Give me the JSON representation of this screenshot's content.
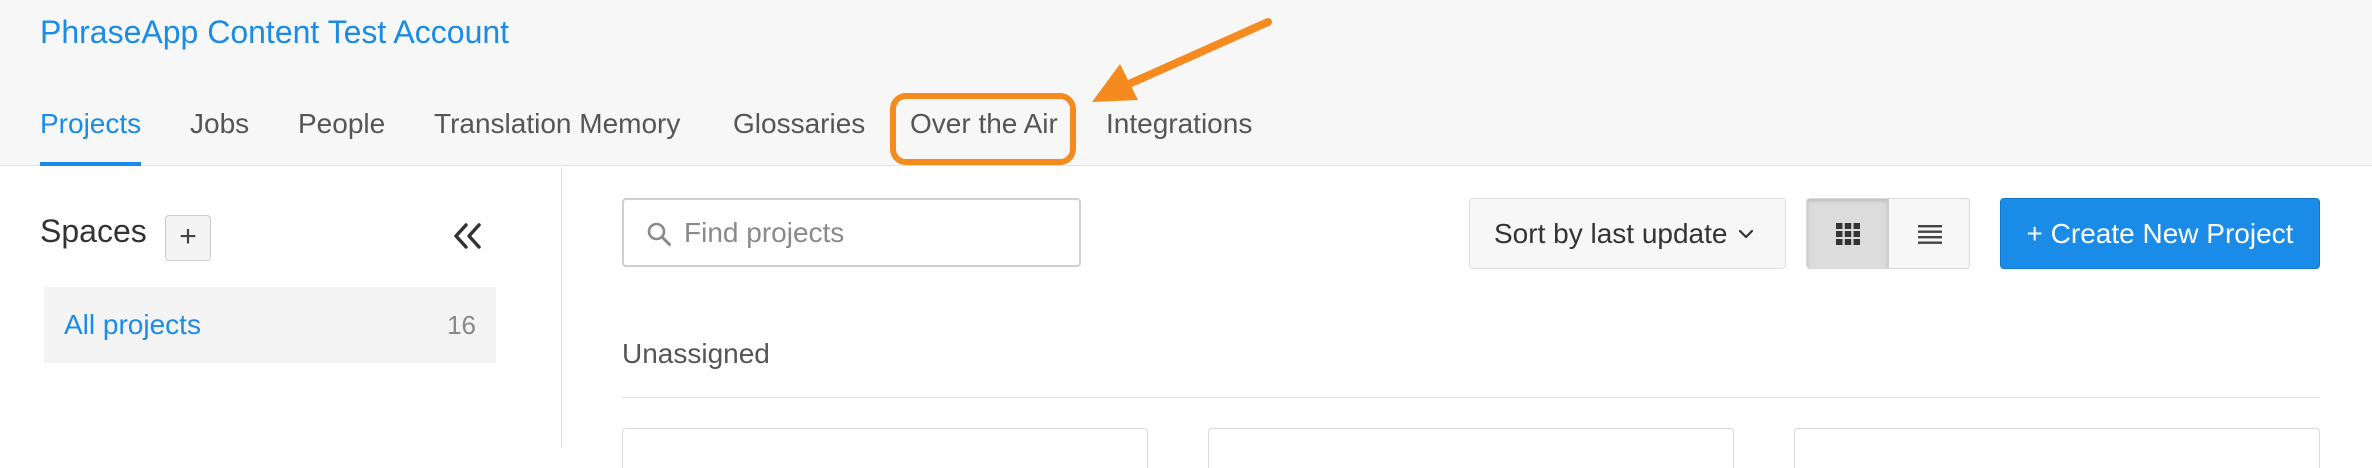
{
  "header": {
    "account_title": "PhraseApp Content Test Account",
    "nav": {
      "tabs": [
        {
          "label": "Projects",
          "active": true
        },
        {
          "label": "Jobs",
          "active": false
        },
        {
          "label": "People",
          "active": false
        },
        {
          "label": "Translation Memory",
          "active": false
        },
        {
          "label": "Glossaries",
          "active": false
        },
        {
          "label": "Over the Air",
          "active": false,
          "highlighted": true
        },
        {
          "label": "Integrations",
          "active": false
        }
      ]
    }
  },
  "sidebar": {
    "title": "Spaces",
    "add_label": "+",
    "collapse_icon": "double-chevron-left-icon",
    "items": [
      {
        "label": "All projects",
        "count": "16",
        "active": true
      }
    ]
  },
  "main": {
    "search": {
      "placeholder": "Find projects",
      "value": ""
    },
    "sort": {
      "label": "Sort by last update"
    },
    "view_toggle": {
      "selected": "grid"
    },
    "create_button": {
      "label": "+ Create New Project"
    },
    "section": {
      "label": "Unassigned"
    }
  },
  "colors": {
    "accent": "#1a8be6",
    "annotation": "#f58a1f",
    "header_bg": "#f7f7f7"
  }
}
